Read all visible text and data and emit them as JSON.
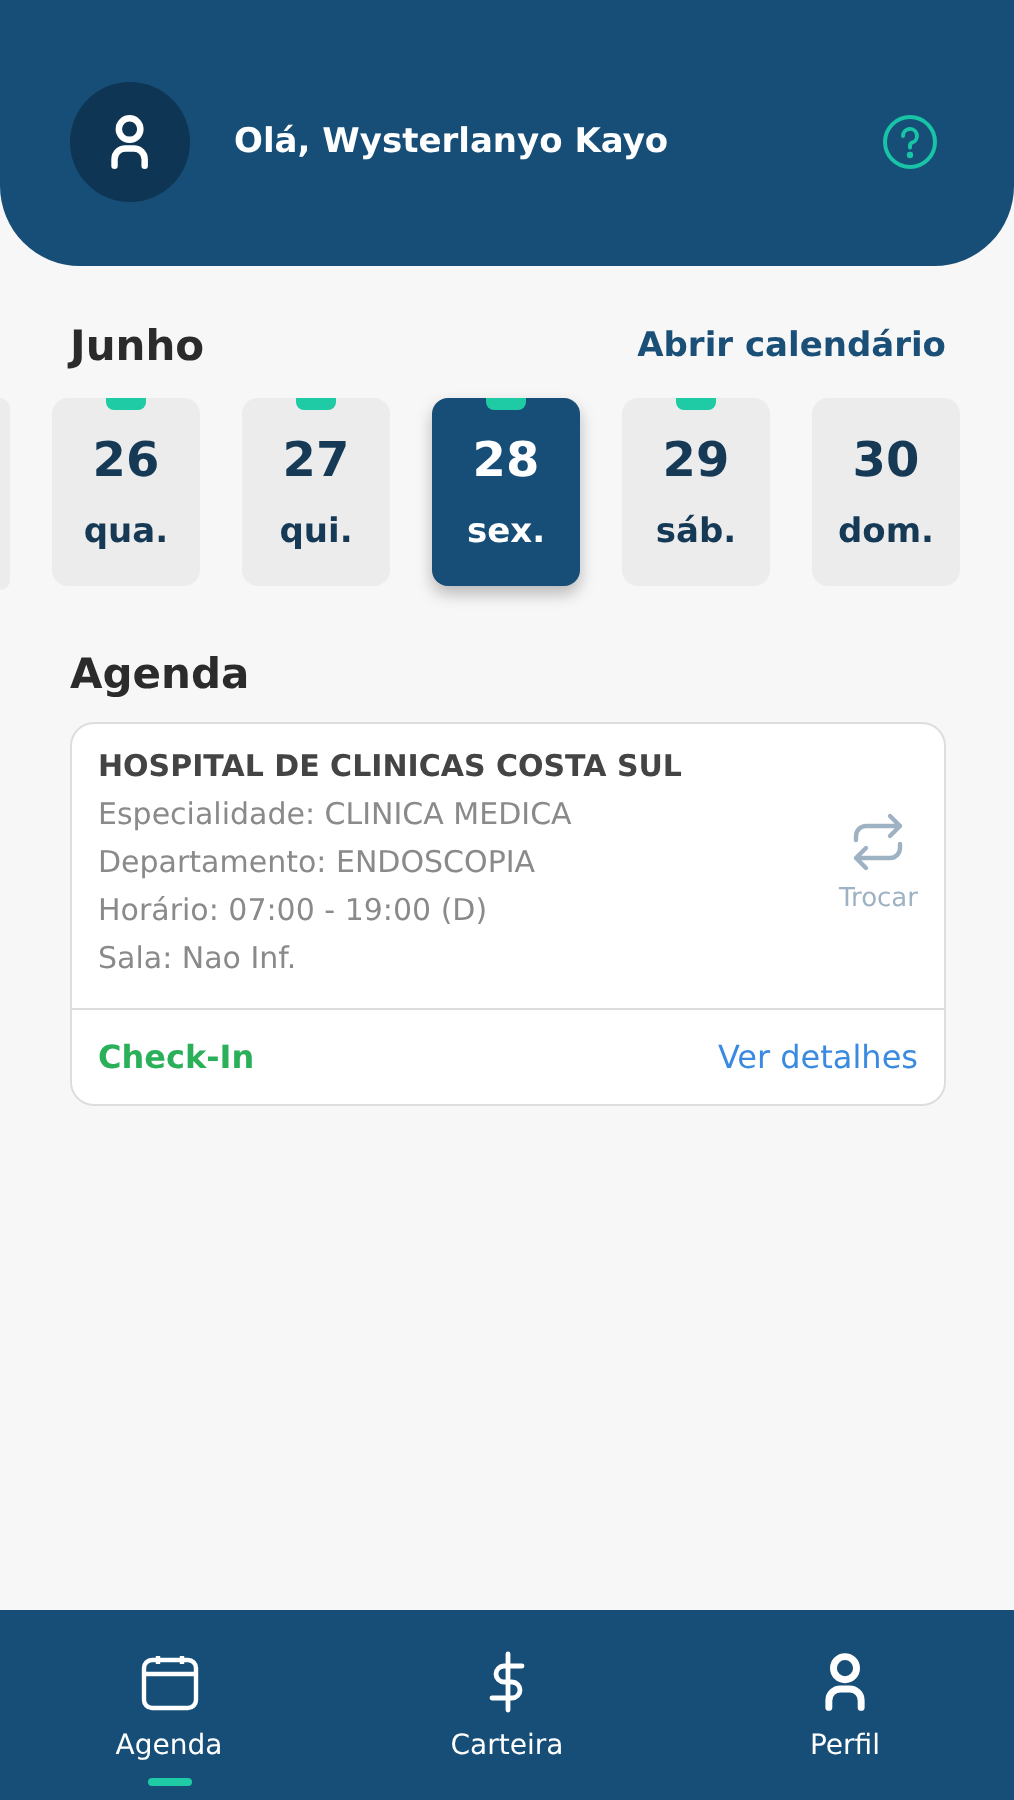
{
  "header": {
    "greeting": "Olá, Wysterlanyo Kayo"
  },
  "calendar": {
    "month": "Junho",
    "open_link": "Abrir calendário",
    "days": [
      {
        "number": "26",
        "weekday": "qua.",
        "marked": true,
        "selected": false
      },
      {
        "number": "27",
        "weekday": "qui.",
        "marked": true,
        "selected": false
      },
      {
        "number": "28",
        "weekday": "sex.",
        "marked": true,
        "selected": true
      },
      {
        "number": "29",
        "weekday": "sáb.",
        "marked": true,
        "selected": false
      },
      {
        "number": "30",
        "weekday": "dom.",
        "marked": false,
        "selected": false
      }
    ]
  },
  "agenda": {
    "title": "Agenda",
    "appointments": [
      {
        "hospital": "HOSPITAL DE CLINICAS COSTA SUL",
        "details": [
          "Especialidade: CLINICA MEDICA",
          "Departamento: ENDOSCOPIA",
          "Horário: 07:00 - 19:00 (D)",
          "Sala: Nao Inf."
        ],
        "swap_label": "Trocar",
        "checkin": "Check-In",
        "details_link": "Ver detalhes"
      }
    ]
  },
  "nav": [
    {
      "label": "Agenda",
      "kind": "calendar",
      "selected": true
    },
    {
      "label": "Carteira",
      "kind": "dollar",
      "selected": false
    },
    {
      "label": "Perfil",
      "kind": "user",
      "selected": false
    }
  ]
}
